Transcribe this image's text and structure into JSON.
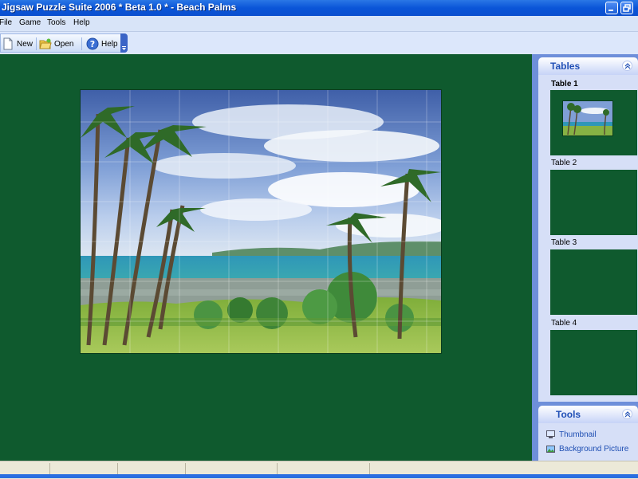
{
  "window": {
    "title": "Jigsaw Puzzle Suite 2006 * Beta 1.0 * - Beach Palms"
  },
  "menu": [
    {
      "label": "File"
    },
    {
      "label": "Game"
    },
    {
      "label": "Tools"
    },
    {
      "label": "Help"
    }
  ],
  "toolbar": {
    "new_label": "New",
    "open_label": "Open",
    "help_label": "Help"
  },
  "tables_panel": {
    "title": "Tables",
    "items": [
      {
        "label": "Table 1",
        "active": true
      },
      {
        "label": "Table 2",
        "active": false
      },
      {
        "label": "Table 3",
        "active": false
      },
      {
        "label": "Table 4",
        "active": false
      }
    ]
  },
  "tools_panel": {
    "title": "Tools",
    "links": [
      {
        "label": "Thumbnail",
        "icon": "monitor-icon"
      },
      {
        "label": "Background Picture",
        "icon": "picture-icon"
      }
    ]
  },
  "colors": {
    "table_felt": "#0f5a2e",
    "titlebar": "#0a55d8",
    "panel_bg": "#6e8fda",
    "link": "#1f4fb3"
  }
}
